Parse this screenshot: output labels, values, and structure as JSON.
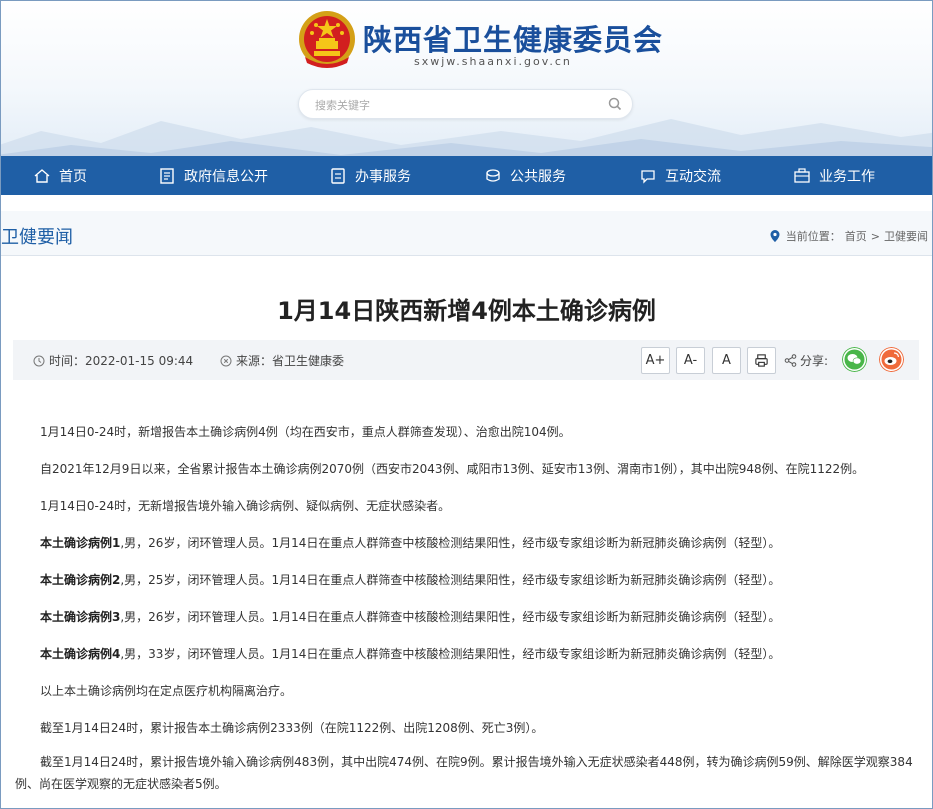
{
  "header": {
    "title": "陕西省卫生健康委员会",
    "domain": "sxwjw.shaanxi.gov.cn",
    "search_placeholder": "搜索关键字",
    "brand_color": "#1f5fa6"
  },
  "nav": {
    "items": [
      {
        "label": "首页",
        "icon": "home-icon"
      },
      {
        "label": "政府信息公开",
        "icon": "document-list-icon"
      },
      {
        "label": "办事服务",
        "icon": "service-icon"
      },
      {
        "label": "公共服务",
        "icon": "public-service-icon"
      },
      {
        "label": "互动交流",
        "icon": "chat-icon"
      },
      {
        "label": "业务工作",
        "icon": "work-icon"
      }
    ]
  },
  "section": {
    "title": "卫健要闻",
    "breadcrumb_prefix": "当前位置：",
    "breadcrumb": [
      "首页",
      "卫健要闻"
    ],
    "separator": ">"
  },
  "article": {
    "title": "1月14日陕西新增4例本土确诊病例",
    "time_label": "时间：",
    "time": "2022-01-15 09:44",
    "source_label": "来源：",
    "source": "省卫生健康委",
    "font_buttons": [
      "A+",
      "A-",
      "A"
    ],
    "share_label": "分享:",
    "paragraphs": [
      "1月14日0-24时，新增报告本土确诊病例4例（均在西安市，重点人群筛查发现）、治愈出院104例。",
      "自2021年12月9日以来，全省累计报告本土确诊病例2070例（西安市2043例、咸阳市13例、延安市13例、渭南市1例），其中出院948例、在院1122例。",
      "1月14日0-24时，无新增报告境外输入确诊病例、疑似病例、无症状感染者。"
    ],
    "cases": [
      {
        "label": "本土确诊病例1",
        "text": ",男，26岁，闭环管理人员。1月14日在重点人群筛查中核酸检测结果阳性，经市级专家组诊断为新冠肺炎确诊病例（轻型）。"
      },
      {
        "label": "本土确诊病例2",
        "text": ",男，25岁，闭环管理人员。1月14日在重点人群筛查中核酸检测结果阳性，经市级专家组诊断为新冠肺炎确诊病例（轻型）。"
      },
      {
        "label": "本土确诊病例3",
        "text": ",男，26岁，闭环管理人员。1月14日在重点人群筛查中核酸检测结果阳性，经市级专家组诊断为新冠肺炎确诊病例（轻型）。"
      },
      {
        "label": "本土确诊病例4",
        "text": ",男，33岁，闭环管理人员。1月14日在重点人群筛查中核酸检测结果阳性，经市级专家组诊断为新冠肺炎确诊病例（轻型）。"
      }
    ],
    "after": [
      "以上本土确诊病例均在定点医疗机构隔离治疗。",
      "截至1月14日24时，累计报告本土确诊病例2333例（在院1122例、出院1208例、死亡3例）。",
      "截至1月14日24时，累计报告境外输入确诊病例483例，其中出院474例、在院9例。累计报告境外输入无症状感染者448例，转为确诊病例59例、解除医学观察384例、尚在医学观察的无症状感染者5例。"
    ]
  }
}
